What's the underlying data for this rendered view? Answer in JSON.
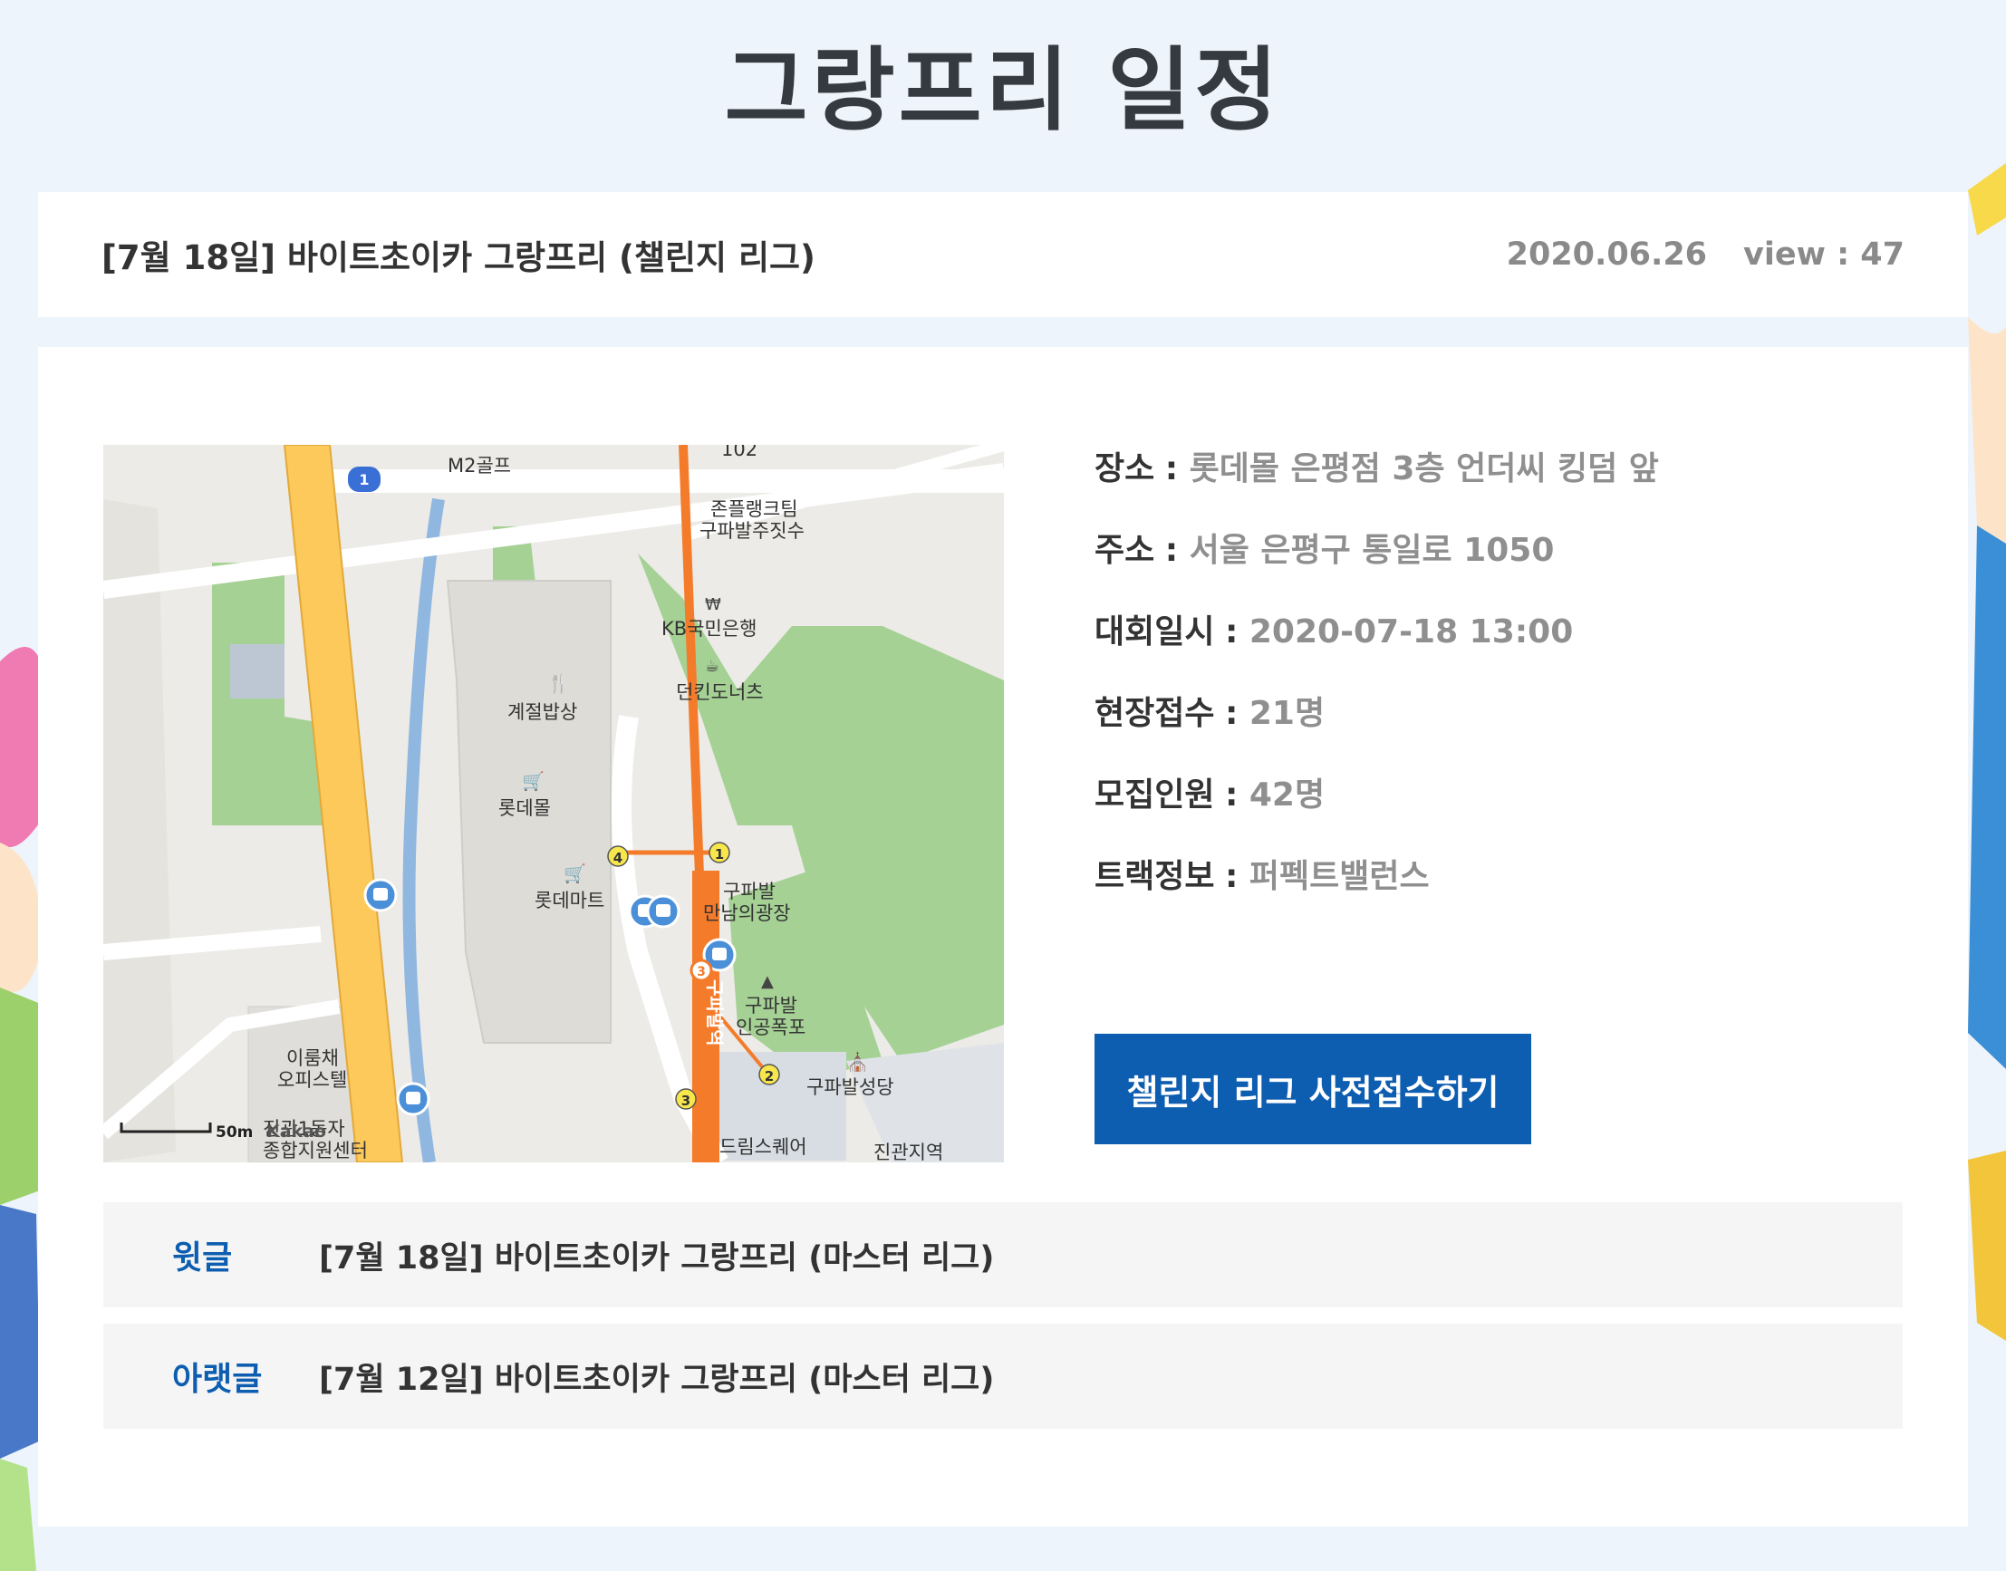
{
  "page": {
    "title": "그랑프리 일정"
  },
  "post": {
    "title": "[7월 18일] 바이트초이카 그랑프리 (챌린지 리그)",
    "date": "2020.06.26",
    "views": "view : 47"
  },
  "map": {
    "labels": {
      "m2golf": "M2골프",
      "bldg102": "102",
      "jonplank1": "존플랭크팀",
      "jonplank2": "구파발주짓수",
      "kb": "KB국민은행",
      "dunkin": "던킨도너츠",
      "season": "계절밥상",
      "lottemall": "롯데몰",
      "lottemart": "롯데마트",
      "plaza1": "구파발",
      "plaza2": "만남의광장",
      "fall1": "구파발",
      "fall2": "인공폭포",
      "church": "구파발성당",
      "officetel1": "이룸채",
      "officetel2": "오피스텔",
      "station": "구파발역",
      "dreamsquare": "드림스퀘어",
      "jingwan": "진관지역",
      "bottom_left": "진관1동자",
      "bottom_left2": "종합지원센터",
      "scale": "50m",
      "kakao": "Kakao"
    },
    "exits": [
      "1",
      "2",
      "3",
      "4"
    ],
    "route_badge": "1",
    "line_badge": "3",
    "colors": {
      "road_main": "#fdc95a",
      "subway_line": "#f47b2a",
      "green": "#a5d195",
      "water": "#8fb7e0",
      "bus": "#4a8fd8"
    }
  },
  "info": {
    "rows": [
      {
        "label": "장소",
        "value": "롯데몰 은평점 3층 언더씨 킹덤 앞"
      },
      {
        "label": "주소",
        "value": "서울 은평구 통일로 1050"
      },
      {
        "label": "대회일시",
        "value": "2020-07-18 13:00"
      },
      {
        "label": "현장접수",
        "value": "21명"
      },
      {
        "label": "모집인원",
        "value": "42명"
      },
      {
        "label": "트랙정보",
        "value": "퍼펙트밸런스"
      }
    ],
    "separator": ":"
  },
  "apply_button": "챌린지 리그 사전접수하기",
  "navigation": {
    "prev": {
      "label": "윗글",
      "title": "[7월 18일] 바이트초이카 그랑프리 (마스터 리그)"
    },
    "next": {
      "label": "아랫글",
      "title": "[7월 12일] 바이트초이카 그랑프리 (마스터 리그)"
    }
  }
}
